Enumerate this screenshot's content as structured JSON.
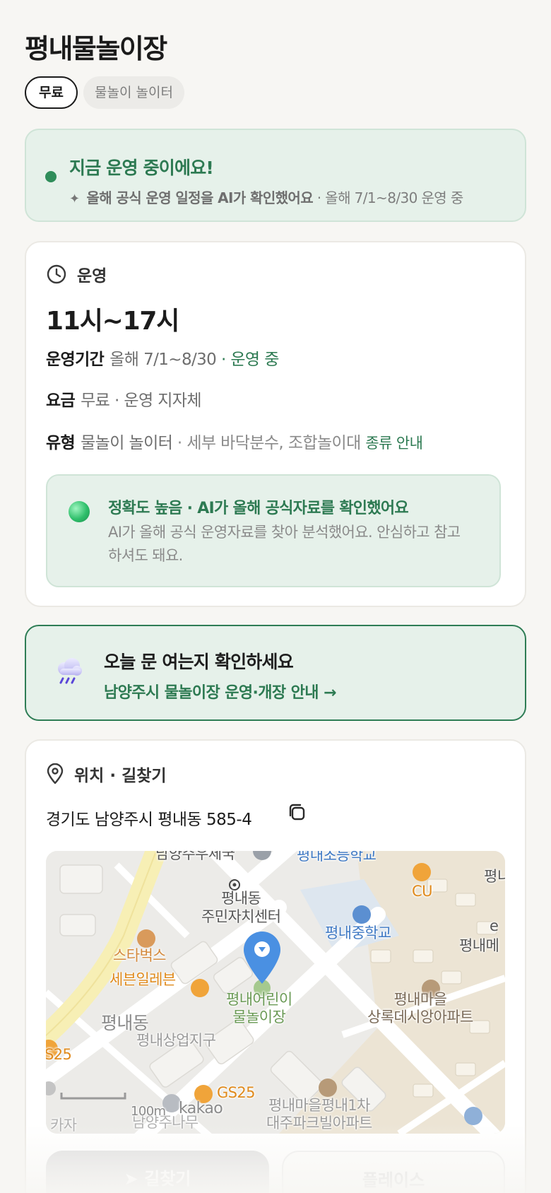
{
  "header": {
    "title": "평내물놀이장",
    "chip_fee": "무료",
    "chip_type": "물놀이 놀이터"
  },
  "status": {
    "title": "지금 운영 중이에요!",
    "ai_note": "올해 공식 운영 일정을 AI가 확인했어요",
    "schedule": "· 올해 7/1~8/30 운영 중",
    "colors": {
      "accent": "#2d7a52",
      "card_bg": "#e6f1ea"
    }
  },
  "operation": {
    "heading": "운영",
    "hours": "11시~17시",
    "period_label": "운영기간",
    "period_value": "올해 7/1~8/30",
    "period_status": "· 운영 중",
    "fee_label": "요금",
    "fee_value": "무료 · 운영 지자체",
    "type_label": "유형",
    "type_value": "물놀이 놀이터",
    "type_detail": "· 세부 바닥분수, 조합놀이대",
    "type_link": "종류 안내",
    "accuracy_title": "정확도 높음 · AI가 올해 공식자료를 확인했어요",
    "accuracy_desc": "AI가 올해 공식 운영자료를 찾아 분석했어요. 안심하고 참고하셔도 돼요."
  },
  "check": {
    "title": "오늘 문 여는지 확인하세요",
    "link": "남양주시 물놀이장 운영·개장 안내 →"
  },
  "location": {
    "heading": "위치 · 길찾기",
    "address": "경기도 남양주시 평내동 585-4",
    "map": {
      "labels": {
        "community_center": "평내동\n주민자치센터",
        "cu": "CU",
        "middle_school": "평내중학교",
        "elem_school": "평내초등학교",
        "starbucks": "스타벅스",
        "seven_eleven": "세븐일레븐",
        "playground": "평내어린이\n물놀이장",
        "apt_maeul": "평내마을\n상록데시앙아파트",
        "dong": "평내동",
        "commercial": "평내상업지구",
        "gs25_a": "GS25",
        "gs25_b": "S25",
        "apt_bottom": "평내마을평내1차\n대주파크빌아파트",
        "namyang": "남양주나무",
        "scale": "100m",
        "brand": "kakao",
        "pyeongnae_edge": "평내메",
        "top_left": "남양주우체국",
        "top_right": "평니",
        "e_edge": "e",
        "left_bottom": "카자"
      }
    },
    "btn_route": "길찾기",
    "btn_place": "플레이스"
  }
}
